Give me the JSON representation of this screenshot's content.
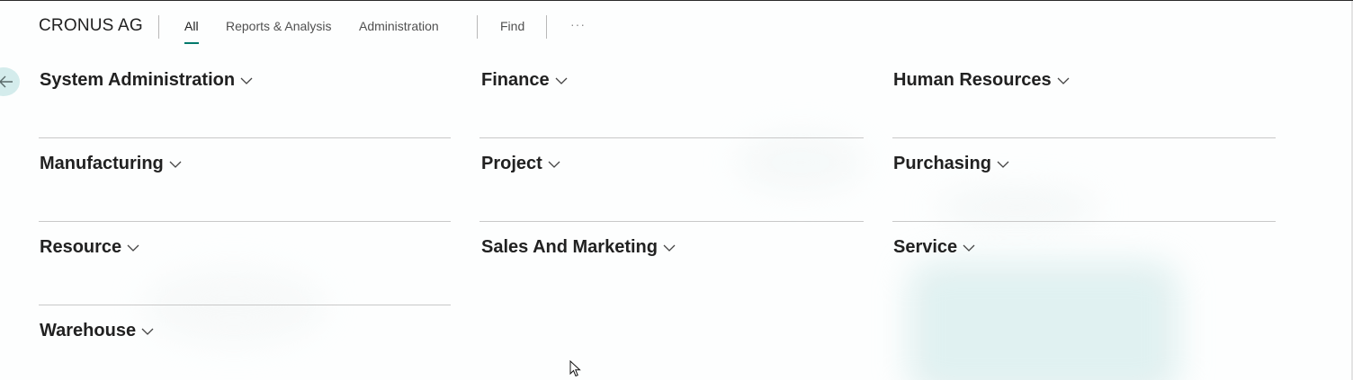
{
  "header": {
    "company": "CRONUS AG",
    "tabs": [
      {
        "label": "All",
        "active": true
      },
      {
        "label": "Reports & Analysis",
        "active": false
      },
      {
        "label": "Administration",
        "active": false
      }
    ],
    "find_label": "Find",
    "more_label": "···"
  },
  "groups": {
    "col1": [
      "System Administration",
      "Manufacturing",
      "Resource",
      "Warehouse"
    ],
    "col2": [
      "Finance",
      "Project",
      "Sales And Marketing"
    ],
    "col3": [
      "Human Resources",
      "Purchasing",
      "Service"
    ]
  },
  "colors": {
    "accent": "#00796b",
    "back_button_bg": "#d4ecec",
    "divider": "#c8c8c8"
  },
  "icons": {
    "back": "arrow-left-icon",
    "expand": "chevron-down-icon"
  }
}
